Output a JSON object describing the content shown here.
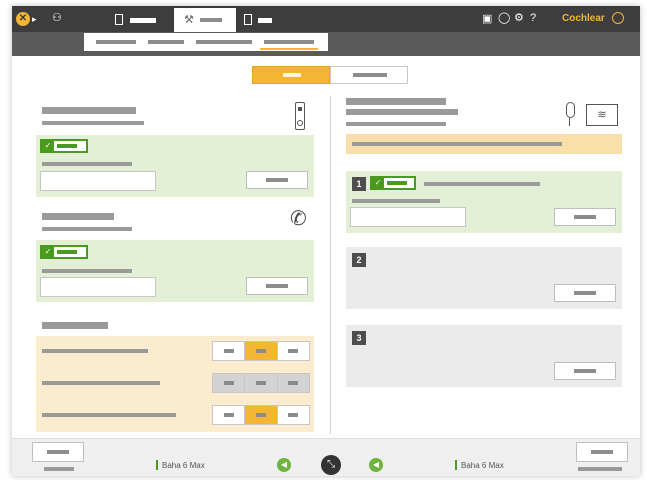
{
  "header": {
    "brand": "Cochlear",
    "brand_color": "#f3b533",
    "icons": [
      "logo-icon",
      "user-icon",
      "device-tab-icon",
      "wrench-icon",
      "device-tab-right-icon",
      "sd-card-icon",
      "chat-icon",
      "gear-icon",
      "help-icon"
    ]
  },
  "colors": {
    "accent": "#f3b533",
    "success": "#4a9a1e",
    "dark_bar": "#3d3d3d"
  },
  "left_panel": {
    "device_icon": "remote-icon",
    "phone_icon": "phone-icon"
  },
  "right_panel": {
    "mic_icon": "microphone-icon",
    "tv_icon": "wireless-tv-icon",
    "slots": [
      {
        "number": "1"
      },
      {
        "number": "2"
      },
      {
        "number": "3"
      }
    ]
  },
  "bottom": {
    "left_device": "Baha 6 Max",
    "right_device": "Baha 6 Max"
  }
}
